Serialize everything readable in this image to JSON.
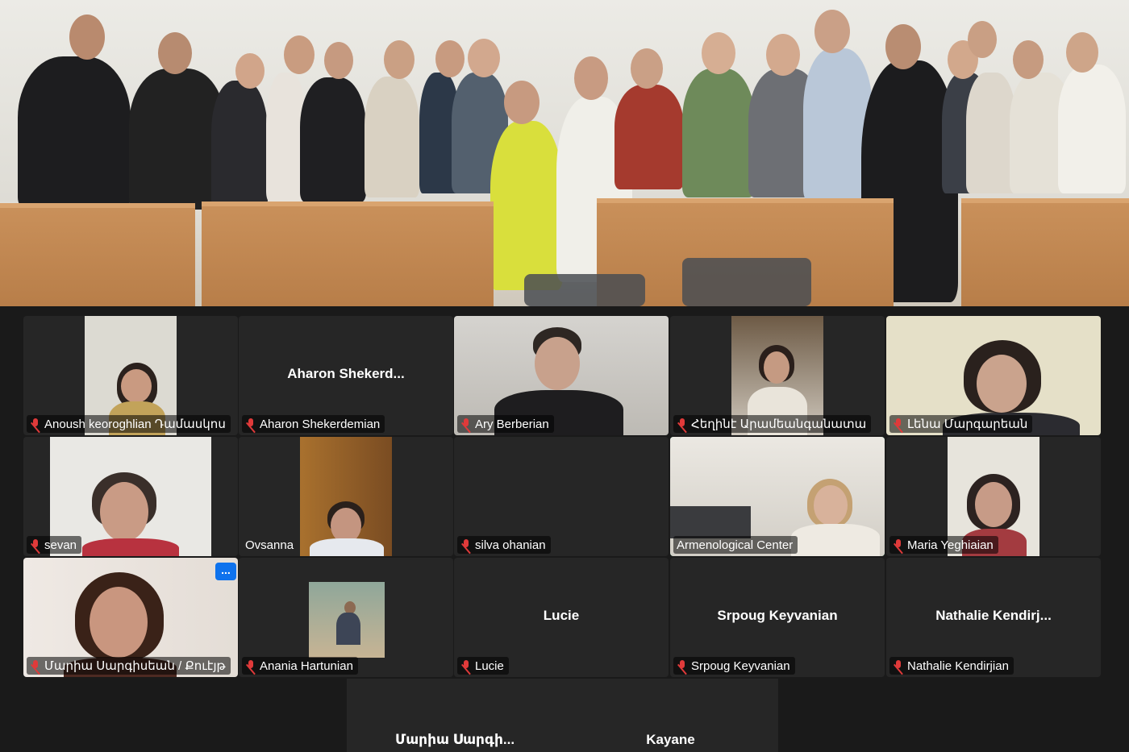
{
  "gallery": {
    "tiles": [
      {
        "name": "Anoush keoroghlian Դամասկոս",
        "muted": true,
        "video": true
      },
      {
        "name": "Aharon Shekerdemian",
        "display_name": "Aharon  Shekerd...",
        "muted": true,
        "video": false
      },
      {
        "name": "Ary Berberian",
        "muted": true,
        "video": true
      },
      {
        "name": "Հեղինէ Արամեանգանատա",
        "muted": true,
        "video": true
      },
      {
        "name": "Լենա Մարգարեան",
        "muted": true,
        "video": true
      },
      {
        "name": "sevan",
        "muted": true,
        "video": true
      },
      {
        "name": "Ovsanna",
        "muted": false,
        "video": true
      },
      {
        "name": "silva ohanian",
        "muted": true,
        "video": false
      },
      {
        "name": "Armenological Center",
        "muted": false,
        "video": true,
        "active_speaker": true
      },
      {
        "name": "Maria Yeghiaian",
        "muted": true,
        "video": true
      },
      {
        "name": "Մարիա Սարգիսեան / Քուէյթ",
        "muted": true,
        "video": true,
        "more_button": "..."
      },
      {
        "name": "Anania Hartunian",
        "muted": true,
        "video": true
      },
      {
        "name": "Lucie",
        "display_name": "Lucie",
        "muted": true,
        "video": false
      },
      {
        "name": "Srpoug Keyvanian",
        "display_name": "Srpoug Keyvanian",
        "muted": true,
        "video": false
      },
      {
        "name": "Nathalie Kendirjian",
        "display_name": "Nathalie  Kendirj...",
        "muted": true,
        "video": false
      },
      {
        "display_name": "Մարիա  Սարգի...",
        "video": false
      },
      {
        "display_name": "Kayane",
        "video": false
      }
    ]
  },
  "colors": {
    "active_outline": "#3fcf8e",
    "muted_mic": "#e03a3a",
    "more_button": "#0e72ed",
    "tile_bg": "#262626"
  }
}
